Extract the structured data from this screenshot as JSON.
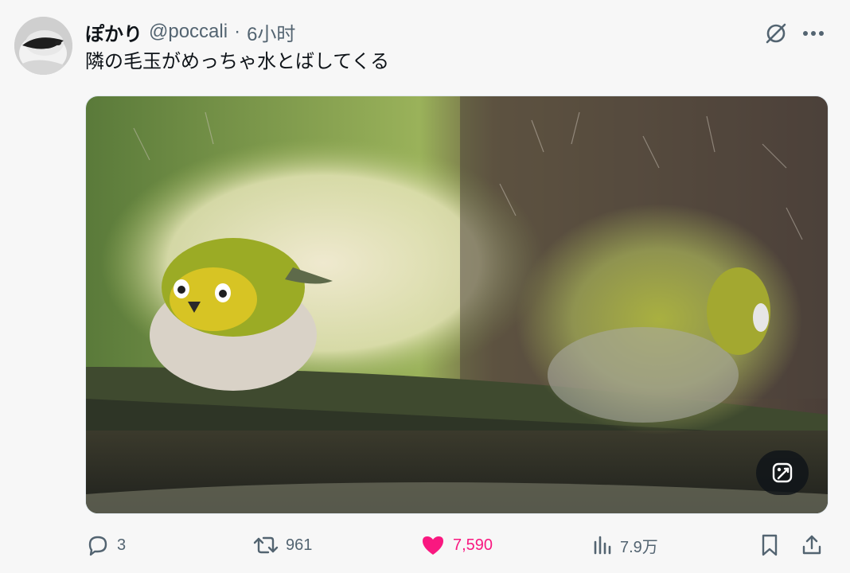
{
  "author": {
    "display_name": "ぽかり",
    "handle": "@poccali",
    "separator": "·",
    "time": "6小时"
  },
  "tweet": {
    "text": "隣の毛玉がめっちゃ水とばしてくる"
  },
  "icons": {
    "grok": "grok-icon",
    "more": "more-icon",
    "edit_image": "edit-image-icon",
    "reply": "reply-icon",
    "retweet": "retweet-icon",
    "like": "heart-icon",
    "views": "views-icon",
    "bookmark": "bookmark-icon",
    "share": "share-icon"
  },
  "metrics": {
    "replies": "3",
    "retweets": "961",
    "likes": "7,590",
    "views": "7.9万"
  },
  "state": {
    "liked": true
  },
  "colors": {
    "like_active": "#f91880",
    "secondary_text": "#536471",
    "primary_text": "#0f1419"
  }
}
